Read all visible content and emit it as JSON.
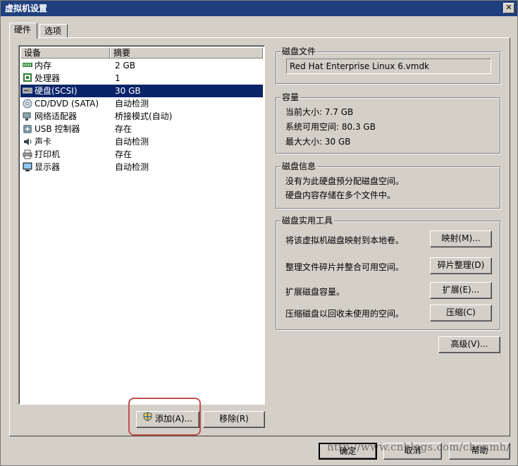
{
  "window": {
    "title": "虚拟机设置",
    "close_glyph": "✕"
  },
  "tabs": [
    {
      "label": "硬件"
    },
    {
      "label": "选项"
    }
  ],
  "device_list": {
    "columns": [
      "设备",
      "摘要"
    ],
    "rows": [
      {
        "name": "内存",
        "summary": "2 GB",
        "icon": "memory-icon"
      },
      {
        "name": "处理器",
        "summary": "1",
        "icon": "processor-icon"
      },
      {
        "name": "硬盘(SCSI)",
        "summary": "30 GB",
        "icon": "hard-disk-icon"
      },
      {
        "name": "CD/DVD (SATA)",
        "summary": "自动检测",
        "icon": "cd-dvd-icon"
      },
      {
        "name": "网络适配器",
        "summary": "桥接模式(自动)",
        "icon": "network-adapter-icon"
      },
      {
        "name": "USB 控制器",
        "summary": "存在",
        "icon": "usb-icon"
      },
      {
        "name": "声卡",
        "summary": "自动检测",
        "icon": "sound-card-icon"
      },
      {
        "name": "打印机",
        "summary": "存在",
        "icon": "printer-icon"
      },
      {
        "name": "显示器",
        "summary": "自动检测",
        "icon": "display-icon"
      }
    ],
    "selected_index": 2
  },
  "list_buttons": {
    "add_label": "添加(A)...",
    "remove_label": "移除(R)"
  },
  "disk_file": {
    "title": "磁盘文件",
    "value": "Red Hat Enterprise Linux 6.vmdk"
  },
  "capacity": {
    "title": "容量",
    "current_size": "当前大小: 7.7 GB",
    "system_free": "系统可用空间: 80.3 GB",
    "max_size": "最大大小: 30 GB"
  },
  "disk_info": {
    "title": "磁盘信息",
    "line1": "没有为此硬盘预分配磁盘空间。",
    "line2": "硬盘内容存储在多个文件中。"
  },
  "disk_utilities": {
    "title": "磁盘实用工具",
    "map_desc": "将该虚拟机磁盘映射到本地卷。",
    "map_label": "映射(M)...",
    "defrag_desc": "整理文件碎片并整合可用空间。",
    "defrag_label": "碎片整理(D)",
    "expand_desc": "扩展磁盘容量。",
    "expand_label": "扩展(E)...",
    "compact_desc": "压缩磁盘以回收未使用的空间。",
    "compact_label": "压缩(C)"
  },
  "advanced_label": "高级(V)...",
  "footer": {
    "ok_label": "确定",
    "cancel_label": "取消",
    "help_label": "帮助"
  },
  "watermark": "http://www.cnblogs.com/chenmh/",
  "colors": {
    "selection": "#0a246a",
    "title_bar": "#1f3f7e",
    "highlight_ring": "#c0504d"
  }
}
